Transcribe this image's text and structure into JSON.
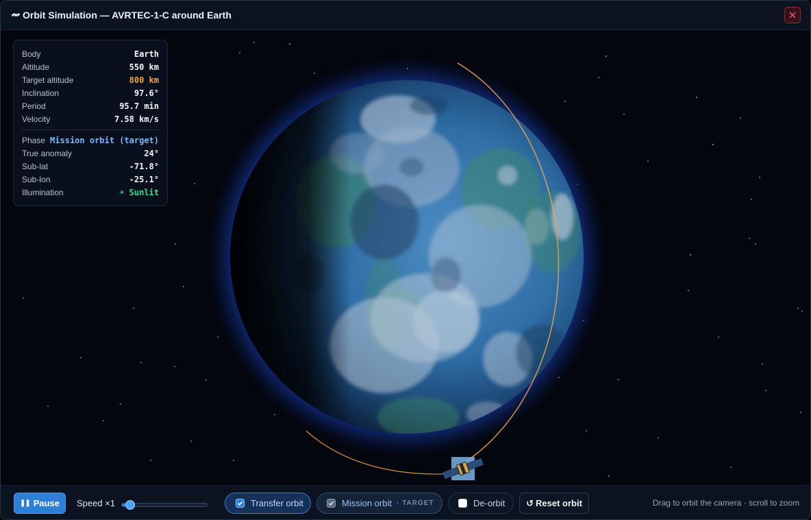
{
  "window": {
    "title": "Orbit Simulation — AVRTEC-1-C around Earth",
    "title_icon": "satellite-icon",
    "close_icon": "close-icon"
  },
  "info": {
    "rows1": [
      {
        "label": "Body",
        "value": "Earth"
      },
      {
        "label": "Altitude",
        "value": "550 km"
      },
      {
        "label": "Target altitude",
        "value": "800 km"
      },
      {
        "label": "Inclination",
        "value": "97.6°"
      },
      {
        "label": "Period",
        "value": "95.7 min"
      },
      {
        "label": "Velocity",
        "value": "7.58 km/s"
      }
    ],
    "rows2": [
      {
        "label": "Phase",
        "value": "Mission orbit (target)"
      },
      {
        "label": "True anomaly",
        "value": "24°"
      },
      {
        "label": "Sub-lat",
        "value": "-71.8°"
      },
      {
        "label": "Sub-lon",
        "value": "-25.1°"
      },
      {
        "label": "Illumination",
        "value": "☀ Sunlit"
      }
    ]
  },
  "controls": {
    "pause_label": "Pause",
    "speed_label": "Speed ×1",
    "speed_level": 0.1,
    "transfer_label": "Transfer orbit",
    "transfer_checked": true,
    "mission_label": "Mission orbit",
    "mission_tag": "· TARGET",
    "mission_checked": true,
    "deorbit_label": "De-orbit",
    "deorbit_checked": false,
    "reset_label": "Reset orbit",
    "hint": "Drag to orbit the camera · scroll to zoom"
  },
  "colors": {
    "accent": "#2f7fd6",
    "orbit": "#f0a54a",
    "sunlit": "#3ddc97",
    "target": "#f0a54a"
  }
}
